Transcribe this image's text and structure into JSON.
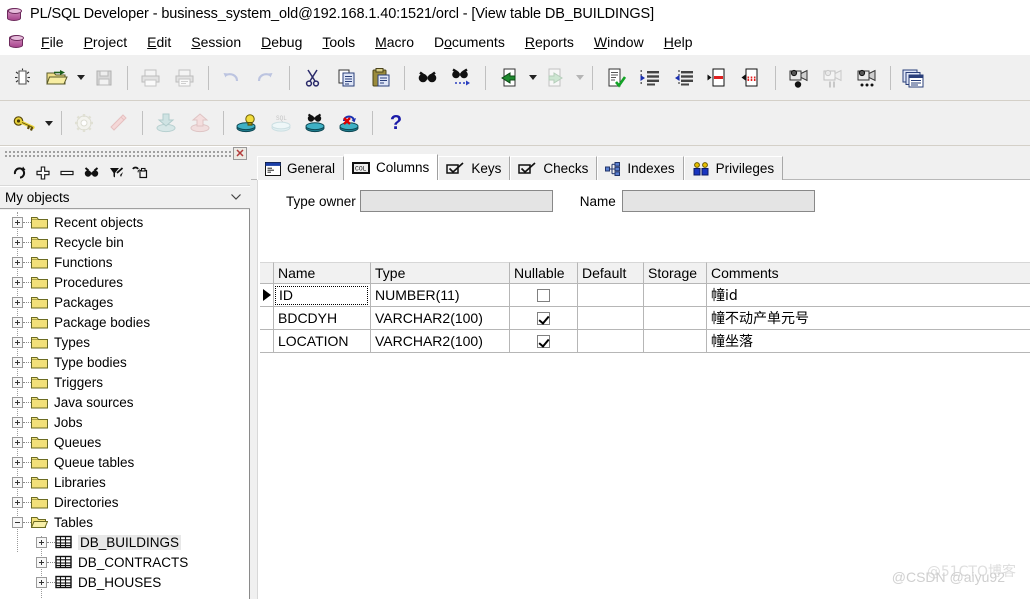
{
  "window": {
    "title": "PL/SQL Developer - business_system_old@192.168.1.40:1521/orcl - [View table DB_BUILDINGS]",
    "app_icon": "database-cylinder-icon"
  },
  "menubar": {
    "items": [
      {
        "label": "File",
        "accel": "F"
      },
      {
        "label": "Project",
        "accel": "P"
      },
      {
        "label": "Edit",
        "accel": "E"
      },
      {
        "label": "Session",
        "accel": "S"
      },
      {
        "label": "Debug",
        "accel": "D"
      },
      {
        "label": "Tools",
        "accel": "T"
      },
      {
        "label": "Macro",
        "accel": "M"
      },
      {
        "label": "Documents",
        "accel": "o"
      },
      {
        "label": "Reports",
        "accel": "R"
      },
      {
        "label": "Window",
        "accel": "W"
      },
      {
        "label": "Help",
        "accel": "H"
      }
    ]
  },
  "toolbar_main": {
    "buttons": [
      {
        "name": "new-icon",
        "enabled": true
      },
      {
        "name": "open-folder-icon",
        "enabled": true
      },
      {
        "name": "open-dropdown-arrow-icon",
        "enabled": true
      },
      {
        "name": "save-icon",
        "enabled": false
      },
      {
        "name": "print-icon",
        "enabled": false
      },
      {
        "name": "print-preview-icon",
        "enabled": false
      },
      {
        "name": "undo-icon",
        "enabled": false
      },
      {
        "name": "redo-icon",
        "enabled": false
      },
      {
        "name": "cut-icon",
        "enabled": true
      },
      {
        "name": "copy-icon",
        "enabled": true
      },
      {
        "name": "paste-icon",
        "enabled": true
      },
      {
        "name": "find-icon",
        "enabled": true
      },
      {
        "name": "find-next-icon",
        "enabled": true
      },
      {
        "name": "previous-document-icon",
        "enabled": true
      },
      {
        "name": "previous-document-dropdown-arrow-icon",
        "enabled": true
      },
      {
        "name": "next-document-icon",
        "enabled": false
      },
      {
        "name": "next-document-dropdown-arrow-icon",
        "enabled": false
      },
      {
        "name": "syntax-check-icon",
        "enabled": true
      },
      {
        "name": "indent-icon",
        "enabled": true
      },
      {
        "name": "outdent-icon",
        "enabled": true
      },
      {
        "name": "comment-icon",
        "enabled": true
      },
      {
        "name": "uncomment-icon",
        "enabled": true
      },
      {
        "name": "record-macro-icon",
        "enabled": true
      },
      {
        "name": "pause-macro-icon",
        "enabled": false
      },
      {
        "name": "play-macro-icon",
        "enabled": true
      },
      {
        "name": "window-list-icon",
        "enabled": true
      }
    ]
  },
  "toolbar_session": {
    "buttons": [
      {
        "name": "logon-key-icon",
        "enabled": true
      },
      {
        "name": "logon-dropdown-arrow-icon",
        "enabled": true
      },
      {
        "name": "execute-icon",
        "enabled": false
      },
      {
        "name": "break-icon",
        "enabled": false
      },
      {
        "name": "commit-icon",
        "enabled": false
      },
      {
        "name": "rollback-icon",
        "enabled": false
      },
      {
        "name": "explain-plan-icon",
        "enabled": true
      },
      {
        "name": "sql-database-icon",
        "enabled": false
      },
      {
        "name": "find-database-object-icon",
        "enabled": true
      },
      {
        "name": "kill-session-icon",
        "enabled": true
      },
      {
        "name": "help-icon",
        "enabled": true
      }
    ]
  },
  "browser": {
    "close_label": "✕",
    "tools": [
      {
        "name": "refresh-icon"
      },
      {
        "name": "add-icon"
      },
      {
        "name": "remove-icon"
      },
      {
        "name": "find-icon"
      },
      {
        "name": "filter-icon"
      },
      {
        "name": "customize-icon"
      }
    ],
    "filter_selected": "My objects",
    "tree": [
      {
        "label": "Recent objects",
        "icon": "folder-icon",
        "expanded": false,
        "level": 1
      },
      {
        "label": "Recycle bin",
        "icon": "folder-icon",
        "expanded": false,
        "level": 1
      },
      {
        "label": "Functions",
        "icon": "folder-icon",
        "expanded": false,
        "level": 1
      },
      {
        "label": "Procedures",
        "icon": "folder-icon",
        "expanded": false,
        "level": 1
      },
      {
        "label": "Packages",
        "icon": "folder-icon",
        "expanded": false,
        "level": 1
      },
      {
        "label": "Package bodies",
        "icon": "folder-icon",
        "expanded": false,
        "level": 1
      },
      {
        "label": "Types",
        "icon": "folder-icon",
        "expanded": false,
        "level": 1
      },
      {
        "label": "Type bodies",
        "icon": "folder-icon",
        "expanded": false,
        "level": 1
      },
      {
        "label": "Triggers",
        "icon": "folder-icon",
        "expanded": false,
        "level": 1
      },
      {
        "label": "Java sources",
        "icon": "folder-icon",
        "expanded": false,
        "level": 1
      },
      {
        "label": "Jobs",
        "icon": "folder-icon",
        "expanded": false,
        "level": 1
      },
      {
        "label": "Queues",
        "icon": "folder-icon",
        "expanded": false,
        "level": 1
      },
      {
        "label": "Queue tables",
        "icon": "folder-icon",
        "expanded": false,
        "level": 1
      },
      {
        "label": "Libraries",
        "icon": "folder-icon",
        "expanded": false,
        "level": 1
      },
      {
        "label": "Directories",
        "icon": "folder-icon",
        "expanded": false,
        "level": 1
      },
      {
        "label": "Tables",
        "icon": "folder-open-icon",
        "expanded": true,
        "level": 1
      },
      {
        "label": "DB_BUILDINGS",
        "icon": "table-icon",
        "expanded": false,
        "level": 2,
        "selected": true
      },
      {
        "label": "DB_CONTRACTS",
        "icon": "table-icon",
        "expanded": false,
        "level": 2,
        "selected": false
      },
      {
        "label": "DB_HOUSES",
        "icon": "table-icon",
        "expanded": false,
        "level": 2,
        "selected": false
      }
    ]
  },
  "main": {
    "tabs": [
      {
        "label": "General",
        "icon": "general-window-icon",
        "active": false
      },
      {
        "label": "Columns",
        "icon": "columns-icon",
        "active": true
      },
      {
        "label": "Keys",
        "icon": "keys-checkbox-icon",
        "active": false
      },
      {
        "label": "Checks",
        "icon": "checks-checkbox-icon",
        "active": false
      },
      {
        "label": "Indexes",
        "icon": "indexes-tree-icon",
        "active": false
      },
      {
        "label": "Privileges",
        "icon": "privileges-people-icon",
        "active": false
      }
    ],
    "filters": {
      "type_owner_label": "Type owner",
      "type_owner_value": "",
      "type_owner_placeholder": "",
      "name_label": "Name",
      "name_value": "",
      "name_placeholder": ""
    },
    "grid": {
      "columns": [
        "Name",
        "Type",
        "Nullable",
        "Default",
        "Storage",
        "Comments"
      ],
      "rows": [
        {
          "current": true,
          "Name": "ID",
          "Type": "NUMBER(11)",
          "Nullable": false,
          "Default": "",
          "Storage": "",
          "Comments": "幢id"
        },
        {
          "current": false,
          "Name": "BDCDYH",
          "Type": "VARCHAR2(100)",
          "Nullable": true,
          "Default": "",
          "Storage": "",
          "Comments": "幢不动产单元号"
        },
        {
          "current": false,
          "Name": "LOCATION",
          "Type": "VARCHAR2(100)",
          "Nullable": true,
          "Default": "",
          "Storage": "",
          "Comments": "幢坐落"
        }
      ]
    }
  },
  "watermarks": {
    "cto": "@51CTO博客",
    "csdn": "@CSDN @aiyu92"
  },
  "colors": {
    "window_bg": "#f0f0f0",
    "panel_bg": "#ffffff",
    "grid_header_bg": "#f1f1f1",
    "grid_line": "#b6b6b6",
    "folder_yellow": "#f2e07a",
    "accent_blue": "#0000cc"
  }
}
